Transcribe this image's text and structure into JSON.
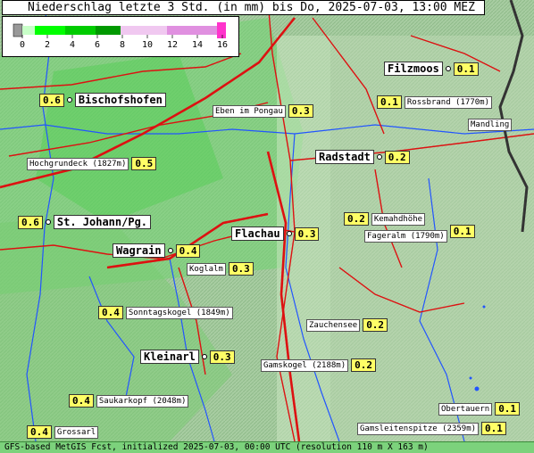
{
  "title": "Niederschlag letzte 3 Std. (in mm) bis Do, 2025-07-03, 13:00 MEZ",
  "legend": {
    "ticks": [
      "0",
      "2",
      "4",
      "6",
      "8",
      "10",
      "12",
      "14",
      "16"
    ],
    "colors": [
      "#c8ffc8",
      "#00ff00",
      "#00cc00",
      "#009900",
      "#f0c8f0",
      "#e090e0",
      "#ff33cc"
    ]
  },
  "footer": "GFS-based MetGIS Fcst, initialized 2025-07-03, 00:00 UTC  (resolution 110 m X 163 m)",
  "places": {
    "filzmoos": {
      "name": "Filzmoos",
      "value": "0.1"
    },
    "bischofshofen": {
      "name": "Bischofshofen",
      "value": "0.6"
    },
    "rossbrand": {
      "name": "Rossbrand (1770m)",
      "value": "0.1"
    },
    "eben": {
      "name": "Eben im Pongau",
      "value": "0.3"
    },
    "mandling": {
      "name": "Mandling",
      "value": ""
    },
    "radstadt": {
      "name": "Radstadt",
      "value": "0.2"
    },
    "hochgrundeck": {
      "name": "Hochgrundeck (1827m)",
      "value": "0.5"
    },
    "stjohann": {
      "name": "St. Johann/Pg.",
      "value": "0.6"
    },
    "kemahdhoehe": {
      "name": "Kemahdhöhe",
      "value": "0.2"
    },
    "fageralm": {
      "name": "Fageralm (1790m)",
      "value": "0.1"
    },
    "flachau": {
      "name": "Flachau",
      "value": "0.3"
    },
    "wagrain": {
      "name": "Wagrain",
      "value": "0.4"
    },
    "koglalm": {
      "name": "Koglalm",
      "value": "0.3"
    },
    "sonntagskogel": {
      "name": "Sonntagskogel (1849m)",
      "value": "0.4"
    },
    "zauchensee": {
      "name": "Zauchensee",
      "value": "0.2"
    },
    "kleinarl": {
      "name": "Kleinarl",
      "value": "0.3"
    },
    "gamskogel": {
      "name": "Gamskogel (2188m)",
      "value": "0.2"
    },
    "saukarkopf": {
      "name": "Saukarkopf (2048m)",
      "value": "0.4"
    },
    "obertauern": {
      "name": "Obertauern",
      "value": "0.1"
    },
    "grossarl": {
      "name": "Grossarl",
      "value": "0.4"
    },
    "gamsleitenspitze": {
      "name": "Gamsleitenspitze (2359m)",
      "value": "0.1"
    }
  }
}
